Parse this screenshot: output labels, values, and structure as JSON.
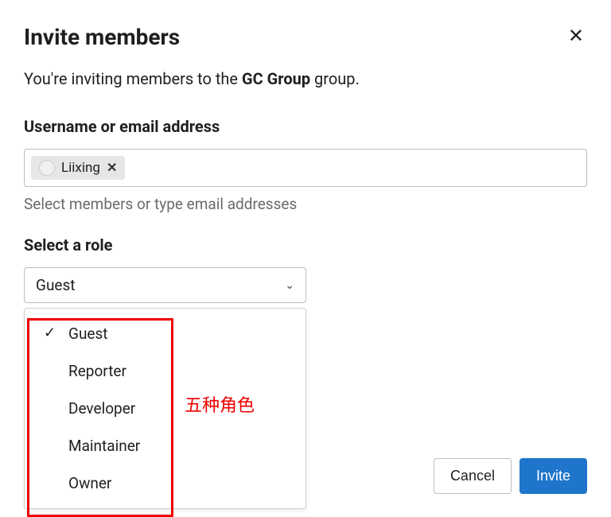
{
  "modal": {
    "title": "Invite members",
    "subtitle_prefix": "You're inviting members to the ",
    "subtitle_group": "GC Group",
    "subtitle_suffix": " group."
  },
  "username": {
    "label": "Username or email address",
    "token_name": "Liixing",
    "helper": "Select members or type email addresses"
  },
  "role": {
    "label": "Select a role",
    "selected": "Guest",
    "options": {
      "0": "Guest",
      "1": "Reporter",
      "2": "Developer",
      "3": "Maintainer",
      "4": "Owner"
    }
  },
  "annotation": {
    "text": "五种角色"
  },
  "footer": {
    "cancel": "Cancel",
    "invite": "Invite"
  }
}
